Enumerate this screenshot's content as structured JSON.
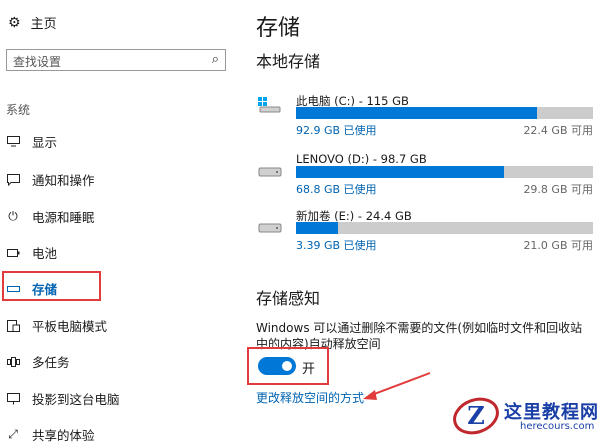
{
  "sidebar": {
    "home_label": "主页",
    "search_placeholder": "查找设置",
    "section_label": "系统",
    "items": [
      {
        "label": "显示",
        "icon": "monitor-icon"
      },
      {
        "label": "通知和操作",
        "icon": "notification-icon"
      },
      {
        "label": "电源和睡眠",
        "icon": "power-icon"
      },
      {
        "label": "电池",
        "icon": "battery-icon"
      },
      {
        "label": "存储",
        "icon": "storage-icon",
        "active": true
      },
      {
        "label": "平板电脑模式",
        "icon": "tablet-icon"
      },
      {
        "label": "多任务",
        "icon": "multitask-icon"
      },
      {
        "label": "投影到这台电脑",
        "icon": "project-icon"
      },
      {
        "label": "共享的体验",
        "icon": "share-icon"
      }
    ]
  },
  "main": {
    "title": "存储",
    "local_storage_heading": "本地存储",
    "drives": [
      {
        "name": "此电脑 (C:) - 115 GB",
        "used": "92.9 GB 已使用",
        "free": "22.4 GB 可用",
        "used_fraction": 0.81,
        "icon": "windows-drive-icon"
      },
      {
        "name": "LENOVO (D:) - 98.7 GB",
        "used": "68.8 GB 已使用",
        "free": "29.8 GB 可用",
        "used_fraction": 0.7,
        "icon": "hard-drive-icon"
      },
      {
        "name": "新加卷 (E:) - 24.4 GB",
        "used": "3.39 GB 已使用",
        "free": "21.0 GB 可用",
        "used_fraction": 0.14,
        "icon": "hard-drive-icon"
      }
    ],
    "storage_sense_heading": "存储感知",
    "storage_sense_desc": "Windows 可以通过删除不需要的文件(例如临时文件和回收站中的内容)自动释放空间",
    "toggle_label": "开",
    "toggle_on": true,
    "change_link": "更改释放空间的方式"
  },
  "colors": {
    "accent": "#0078d7",
    "highlight": "#e23b3b",
    "bar_bg": "#cccccc"
  },
  "watermark": {
    "title": "这里教程网",
    "url": "herecours.com"
  }
}
